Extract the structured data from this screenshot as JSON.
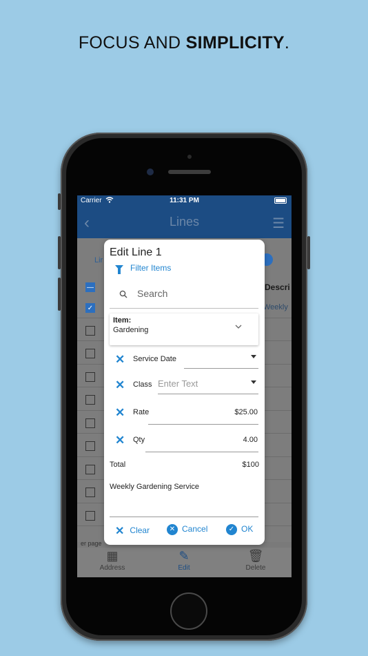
{
  "headline": {
    "normal": "FOCUS AND ",
    "bold": "SIMPLICITY",
    "tail": "."
  },
  "status": {
    "carrier": "Carrier",
    "time": "11:31 PM"
  },
  "nav": {
    "title": "Lines"
  },
  "background": {
    "tab": "Lir",
    "desc_header": "Descri",
    "first_row": "Weekly",
    "pager": "er page"
  },
  "dialog": {
    "title": "Edit Line 1",
    "filter_label": "Filter Items",
    "search_placeholder": "Search",
    "item_label": "Item:",
    "item_value": "Gardening",
    "fields": {
      "service_date": {
        "label": "Service Date",
        "value": ""
      },
      "class": {
        "label": "Class",
        "placeholder": "Enter Text"
      },
      "rate": {
        "label": "Rate",
        "value": "$25.00"
      },
      "qty": {
        "label": "Qty",
        "value": "4.00"
      }
    },
    "total_label": "Total",
    "total_value": "$100",
    "description": "Weekly Gardening Service",
    "actions": {
      "clear": "Clear",
      "cancel": "Cancel",
      "ok": "OK"
    }
  },
  "bottom_tabs": [
    {
      "label": "Address",
      "icon": "address-card-icon"
    },
    {
      "label": "Edit",
      "icon": "edit-icon"
    },
    {
      "label": "Delete",
      "icon": "trash-icon"
    }
  ],
  "colors": {
    "accent": "#2185d0",
    "navbar": "#1c4c83",
    "background": "#9ccbe6"
  }
}
